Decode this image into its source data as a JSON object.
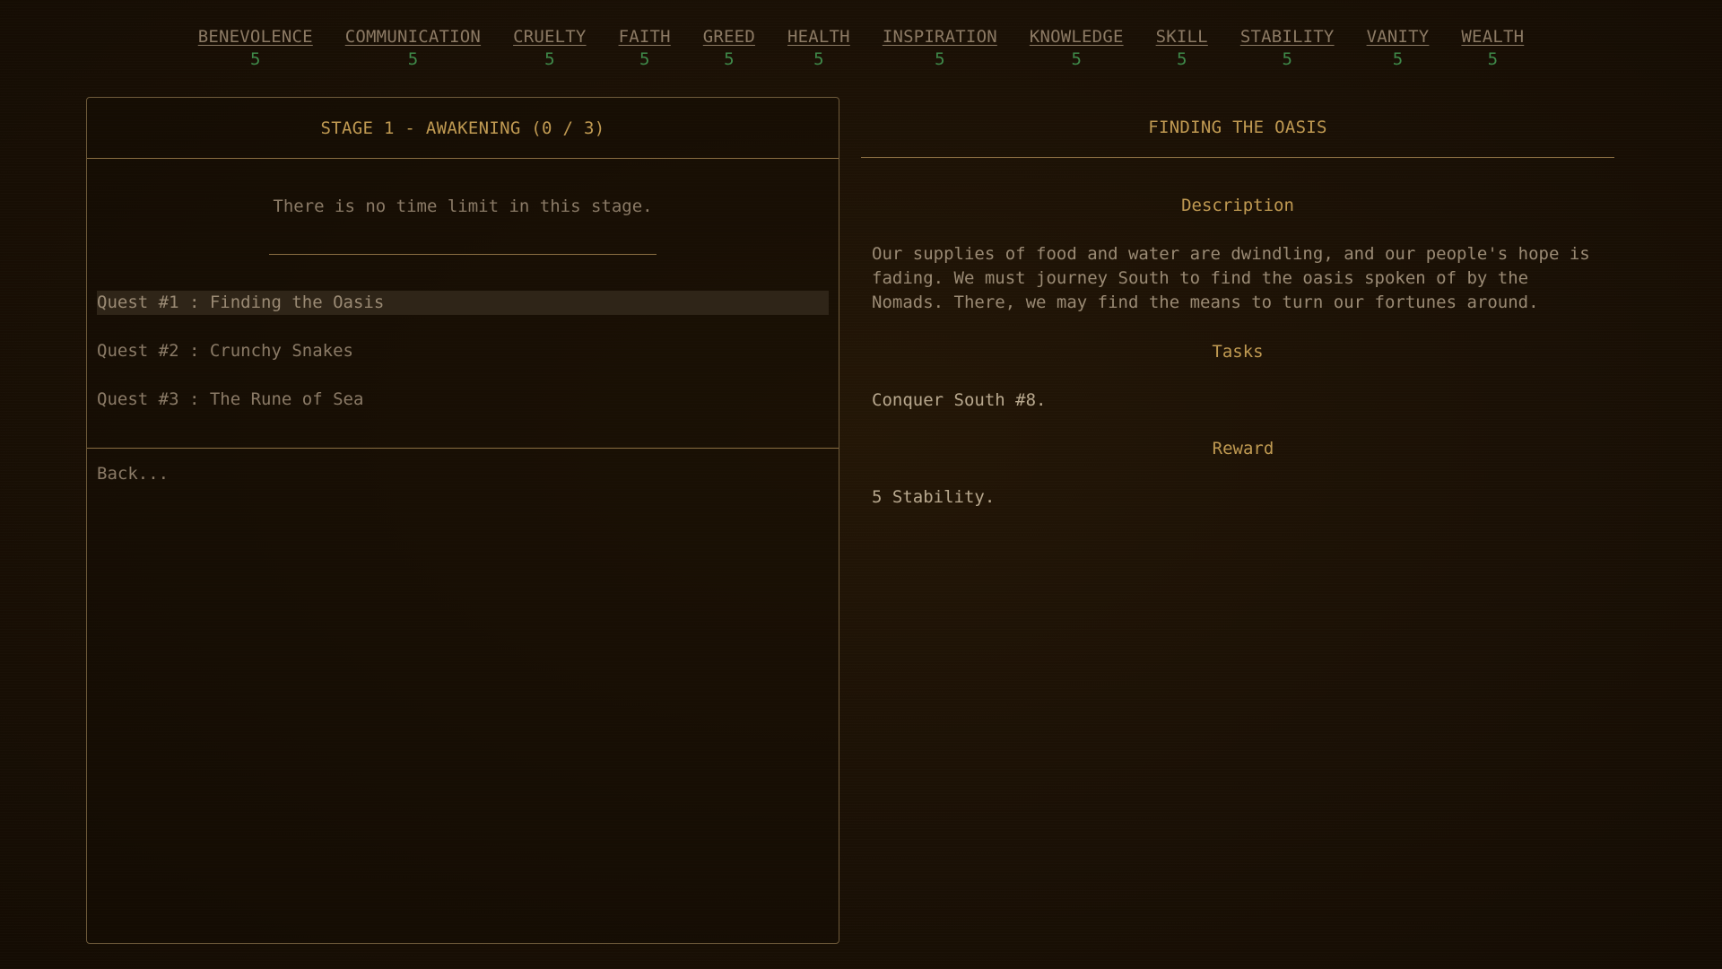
{
  "attributes": [
    {
      "name": "BENEVOLENCE",
      "value": "5"
    },
    {
      "name": "COMMUNICATION",
      "value": "5"
    },
    {
      "name": "CRUELTY",
      "value": "5"
    },
    {
      "name": "FAITH",
      "value": "5"
    },
    {
      "name": "GREED",
      "value": "5"
    },
    {
      "name": "HEALTH",
      "value": "5"
    },
    {
      "name": "INSPIRATION",
      "value": "5"
    },
    {
      "name": "KNOWLEDGE",
      "value": "5"
    },
    {
      "name": "SKILL",
      "value": "5"
    },
    {
      "name": "STABILITY",
      "value": "5"
    },
    {
      "name": "VANITY",
      "value": "5"
    },
    {
      "name": "WEALTH",
      "value": "5"
    }
  ],
  "stage": {
    "title": "STAGE 1 - AWAKENING (0 / 3)",
    "time_note": "There is no time limit in this stage.",
    "quests": [
      {
        "label": "Quest #1 : Finding the Oasis",
        "selected": true
      },
      {
        "label": "Quest #2 : Crunchy Snakes",
        "selected": false
      },
      {
        "label": "Quest #3 : The Rune of Sea",
        "selected": false
      }
    ],
    "back_label": "Back..."
  },
  "detail": {
    "title": "FINDING THE OASIS",
    "description_heading": "Description",
    "description": "Our supplies of food and water are dwindling, and our people's hope is fading. We must journey South to find the oasis spoken of by the Nomads. There, we may find the means to turn our fortunes around.",
    "tasks_heading": "Tasks",
    "tasks": "Conquer South #8.",
    "reward_heading": "Reward",
    "reward": "5 Stability."
  },
  "colors": {
    "background": "#1a1005",
    "accent_gold": "#c09a52",
    "text_muted": "#8a7a66",
    "attribute_value_green": "#3f8a4a",
    "border": "#8a6e42",
    "selected_row": "#2f2518"
  }
}
